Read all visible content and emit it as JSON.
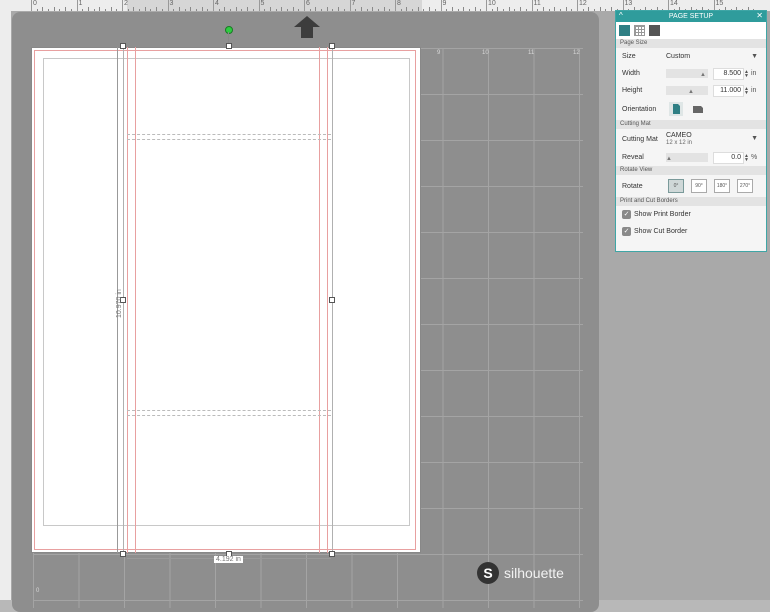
{
  "ruler": {
    "top_numbers": [
      "0",
      "1",
      "2",
      "3",
      "4",
      "5",
      "6",
      "7",
      "8",
      "9",
      "10",
      "11",
      "12",
      "13",
      "14",
      "15"
    ],
    "top_number_labels": [
      "0",
      "1",
      "2",
      "3",
      "4",
      "5",
      "6",
      "7",
      "8",
      "9",
      "10",
      "11",
      "12",
      "13",
      "14",
      "15"
    ]
  },
  "mat": {
    "col_numbers": [
      "9",
      "10",
      "11",
      "12"
    ],
    "row_number": "0",
    "brand_letter": "S",
    "brand_text": "silhouette"
  },
  "page": {
    "height_label": "10.970 in",
    "width_label": "4.192 in"
  },
  "panel": {
    "title": "PAGE SETUP",
    "collapse_icon": "^",
    "close_icon": "✕",
    "sections": {
      "page_size": "Page Size",
      "cutting_mat": "Cutting Mat",
      "rotate_view": "Rotate View",
      "print_cut": "Print and Cut Borders"
    },
    "size": {
      "label": "Size",
      "value": "Custom"
    },
    "width": {
      "label": "Width",
      "value": "8.500",
      "unit": "in"
    },
    "height": {
      "label": "Height",
      "value": "11.000",
      "unit": "in"
    },
    "orientation": {
      "label": "Orientation"
    },
    "cutting_mat": {
      "label": "Cutting Mat",
      "value": "CAMEO",
      "sub": "12 x 12 in"
    },
    "reveal": {
      "label": "Reveal",
      "value": "0.0",
      "unit": "%"
    },
    "rotate": {
      "label": "Rotate",
      "options": [
        "0°",
        "90°",
        "180°",
        "270°"
      ]
    },
    "show_print_border": {
      "label": "Show Print Border",
      "checked": true
    },
    "show_cut_border": {
      "label": "Show Cut Border",
      "checked": true
    }
  },
  "colors": {
    "accent": "#2f9c9c",
    "cut_line": "#e8a0a0",
    "rotate_handle": "#2ecc40"
  }
}
